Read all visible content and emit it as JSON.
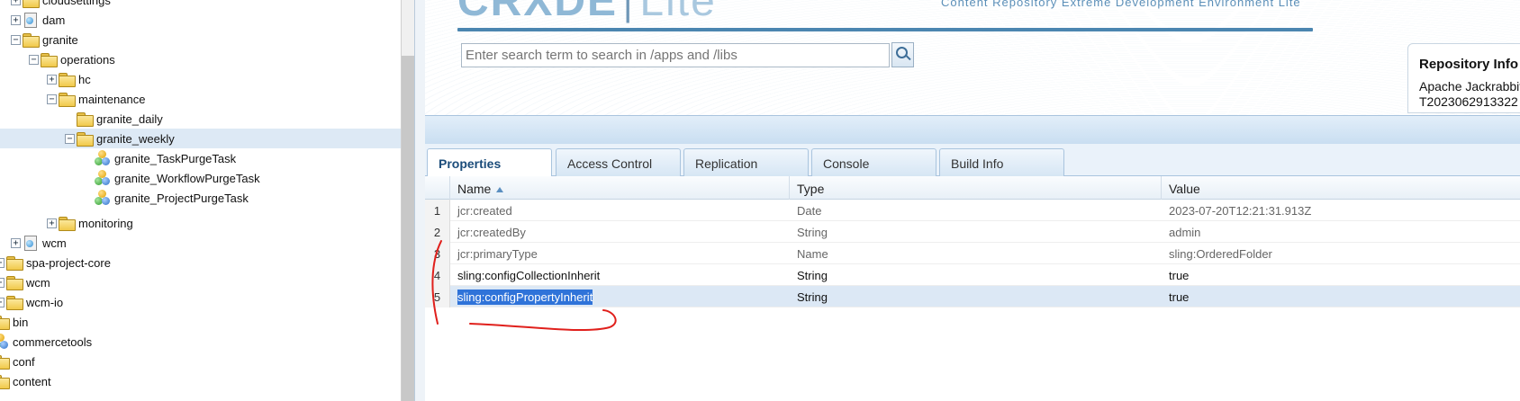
{
  "tree": {
    "nodes": [
      {
        "label": "cloudsettings",
        "icon": "folder-icon",
        "expander": "+"
      },
      {
        "label": "dam",
        "icon": "page-icon",
        "expander": "+"
      },
      {
        "label": "granite",
        "icon": "folder-icon",
        "expander": "-"
      },
      {
        "label": "operations",
        "icon": "folder-icon",
        "expander": "-"
      },
      {
        "label": "hc",
        "icon": "folder-icon",
        "expander": "+"
      },
      {
        "label": "maintenance",
        "icon": "folder-icon",
        "expander": "-"
      },
      {
        "label": "granite_daily",
        "icon": "folder-icon",
        "expander": ""
      },
      {
        "label": "granite_weekly",
        "icon": "folder-icon",
        "expander": "-",
        "selected": true
      },
      {
        "label": "granite_TaskPurgeTask",
        "icon": "component-icon",
        "expander": ""
      },
      {
        "label": "granite_WorkflowPurgeTask",
        "icon": "component-icon",
        "expander": ""
      },
      {
        "label": "granite_ProjectPurgeTask",
        "icon": "component-icon",
        "expander": ""
      },
      {
        "label": "monitoring",
        "icon": "folder-icon",
        "expander": "+"
      },
      {
        "label": "wcm",
        "icon": "page-icon",
        "expander": "+"
      },
      {
        "label": "spa-project-core",
        "icon": "folder-icon",
        "expander": "+"
      },
      {
        "label": "wcm",
        "icon": "folder-icon",
        "expander": "+"
      },
      {
        "label": "wcm-io",
        "icon": "folder-icon",
        "expander": "+"
      },
      {
        "label": "bin",
        "icon": "folder-icon",
        "expander": ""
      },
      {
        "label": "commercetools",
        "icon": "component-icon",
        "expander": ""
      },
      {
        "label": "conf",
        "icon": "folder-icon",
        "expander": ""
      },
      {
        "label": "content",
        "icon": "folder-icon",
        "expander": ""
      }
    ]
  },
  "header": {
    "logo_main": "CRXDE",
    "logo_sep": "|",
    "logo_lite": "Lite",
    "tagline": "Content Repository Extreme Development Environment Lite",
    "search_placeholder": "Enter search term to search in /apps and /libs",
    "repo_info": {
      "title": "Repository Info",
      "line1": "Apache Jackrabbit",
      "line2": "T2023062913322"
    }
  },
  "tabs": [
    "Properties",
    "Access Control",
    "Replication",
    "Console",
    "Build Info"
  ],
  "active_tab": "Properties",
  "grid": {
    "columns": [
      "Name",
      "Type",
      "Value"
    ],
    "sort_column": "Name",
    "rows": [
      {
        "num": "1",
        "name": "jcr:created",
        "type": "Date",
        "value": "2023-07-20T12:21:31.913Z"
      },
      {
        "num": "2",
        "name": "jcr:createdBy",
        "type": "String",
        "value": "admin"
      },
      {
        "num": "3",
        "name": "jcr:primaryType",
        "type": "Name",
        "value": "sling:OrderedFolder"
      },
      {
        "num": "4",
        "name": "sling:configCollectionInherit",
        "type": "String",
        "value": "true"
      },
      {
        "num": "5",
        "name": "sling:configPropertyInherit",
        "type": "String",
        "value": "true",
        "selected": true
      }
    ]
  },
  "colors": {
    "accent": "#4b86b0",
    "annotation": "#e0201c",
    "selection": "#2f73d9"
  }
}
